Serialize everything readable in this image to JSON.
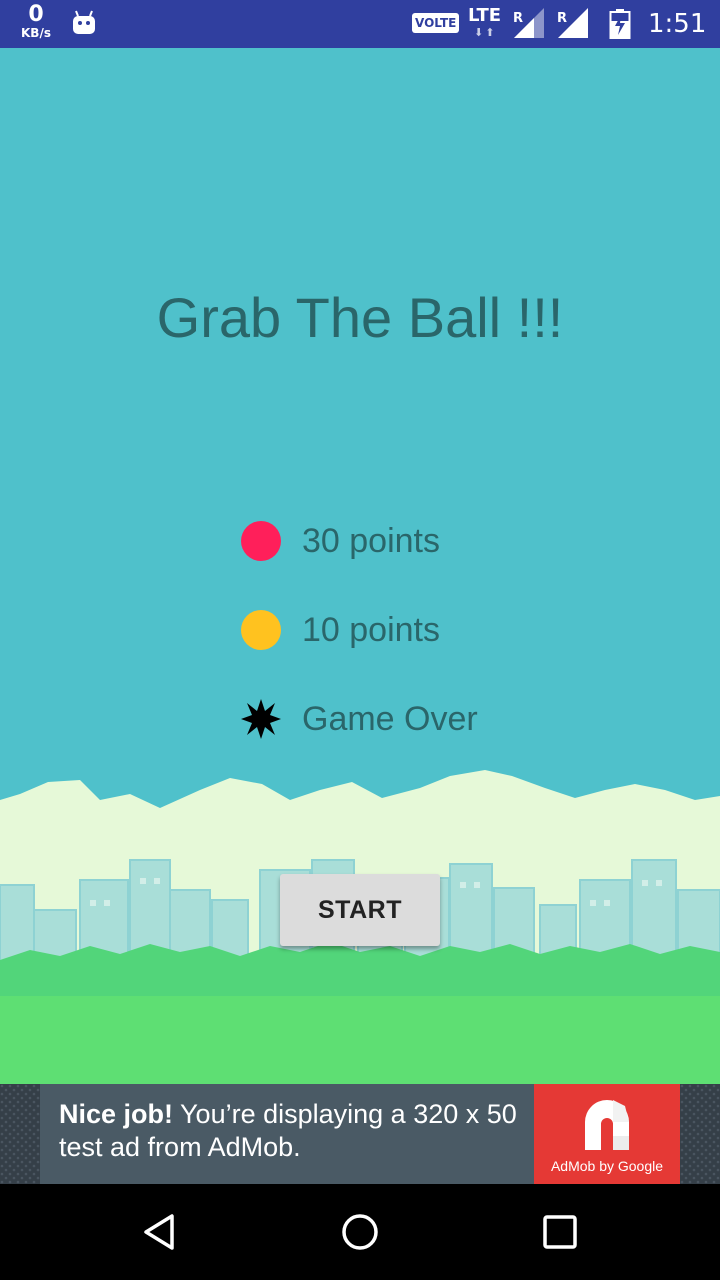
{
  "status_bar": {
    "network_speed_value": "0",
    "network_speed_unit": "KB/s",
    "volte_label": "VOLTE",
    "lte_label": "LTE",
    "roaming_1": "R",
    "roaming_2": "R",
    "time": "1:51",
    "icons": [
      "android-notification-icon",
      "signal-icon",
      "signal-icon",
      "battery-charging-icon"
    ]
  },
  "game": {
    "title": "Grab The Ball !!!",
    "legend": [
      {
        "icon": "red-ball-icon",
        "color": "#FF1F5A",
        "label": "30 points"
      },
      {
        "icon": "yellow-ball-icon",
        "color": "#FFC21F",
        "label": "10 points"
      },
      {
        "icon": "black-burst-icon",
        "color": "#000000",
        "label": "Game Over"
      }
    ],
    "start_label": "START"
  },
  "ad": {
    "headline_bold": "Nice job!",
    "headline_rest": " You’re displaying a 320 x 50 test ad from AdMob.",
    "brand_caption": "AdMob by Google"
  },
  "colors": {
    "sky": "#4FC1CB",
    "status_bar": "#303F9F",
    "ground": "#5EDF73",
    "title_text": "#2A666A",
    "ad_brand": "#E53935"
  },
  "nav_bar": {
    "icons": [
      "back-icon",
      "home-icon",
      "recents-icon"
    ]
  }
}
